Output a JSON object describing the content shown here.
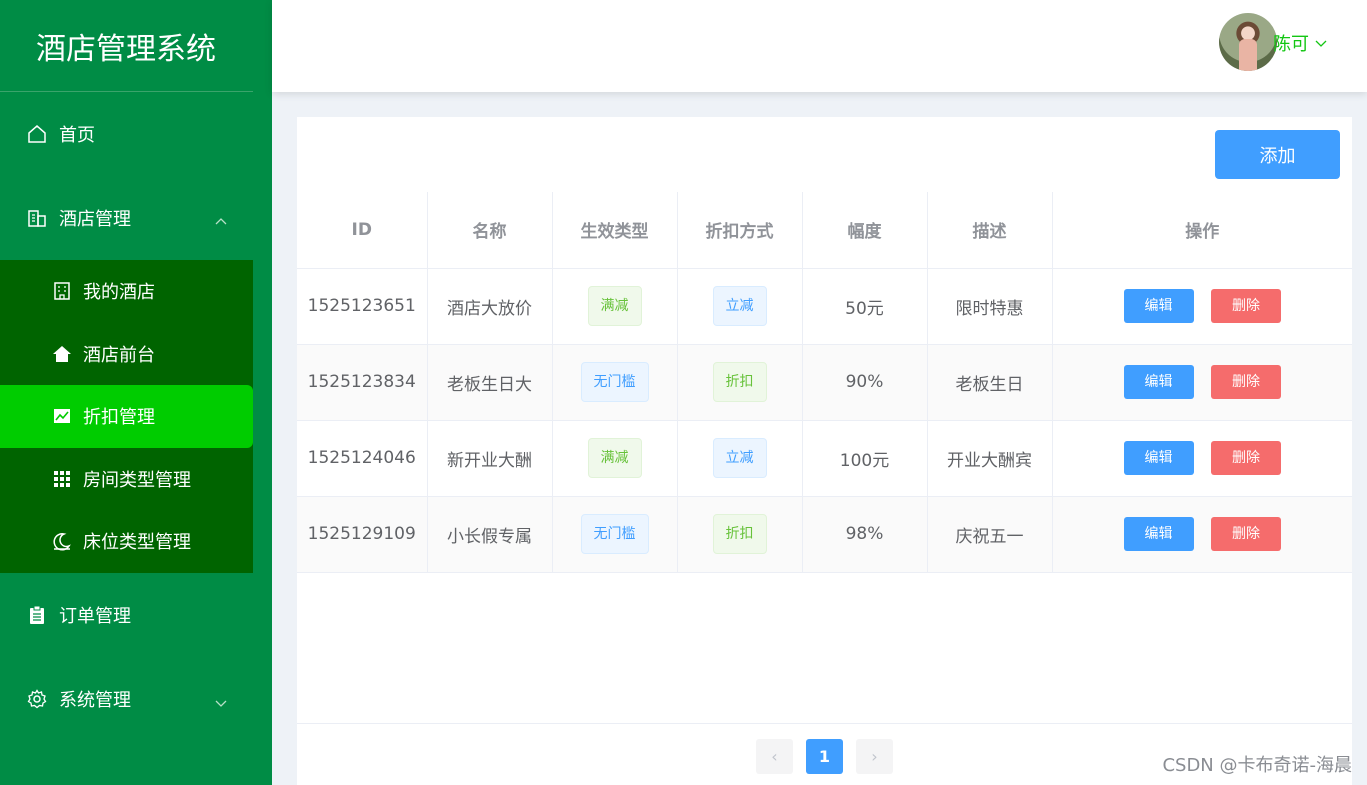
{
  "app": {
    "title": "酒店管理系统"
  },
  "sidebar": {
    "items": [
      {
        "label": "首页",
        "icon": "home-icon"
      },
      {
        "label": "酒店管理",
        "icon": "building-icon",
        "expanded": true,
        "children": [
          {
            "label": "我的酒店",
            "icon": "office-icon"
          },
          {
            "label": "酒店前台",
            "icon": "house-icon"
          },
          {
            "label": "折扣管理",
            "icon": "chart-icon",
            "active": true
          },
          {
            "label": "房间类型管理",
            "icon": "grid-icon"
          },
          {
            "label": "床位类型管理",
            "icon": "moon-icon"
          }
        ]
      },
      {
        "label": "订单管理",
        "icon": "clipboard-icon"
      },
      {
        "label": "系统管理",
        "icon": "gear-icon",
        "expanded": false
      }
    ]
  },
  "header": {
    "username": "陈可"
  },
  "toolbar": {
    "add_label": "添加"
  },
  "table": {
    "headers": [
      "ID",
      "名称",
      "生效类型",
      "折扣方式",
      "幅度",
      "描述",
      "操作"
    ],
    "rows": [
      {
        "id": "1525123651",
        "name": "酒店大放价",
        "effect": "满减",
        "effect_type": "success",
        "mode": "立减",
        "mode_type": "primary",
        "amount": "50元",
        "desc": "限时特惠"
      },
      {
        "id": "1525123834",
        "name": "老板生日大",
        "effect": "无门槛",
        "effect_type": "primary",
        "mode": "折扣",
        "mode_type": "success",
        "amount": "90%",
        "desc": "老板生日"
      },
      {
        "id": "1525124046",
        "name": "新开业大酬",
        "effect": "满减",
        "effect_type": "success",
        "mode": "立减",
        "mode_type": "primary",
        "amount": "100元",
        "desc": "开业大酬宾"
      },
      {
        "id": "1525129109",
        "name": "小长假专属",
        "effect": "无门槛",
        "effect_type": "primary",
        "mode": "折扣",
        "mode_type": "success",
        "amount": "98%",
        "desc": "庆祝五一"
      }
    ],
    "edit_label": "编辑",
    "delete_label": "删除"
  },
  "pagination": {
    "current": "1",
    "prev": "‹",
    "next": "›"
  },
  "watermark": "CSDN @卡布奇诺-海晨",
  "colors": {
    "sidebar": "#008c45",
    "submenu": "#006400",
    "active": "#00cc00",
    "primary": "#409eff",
    "danger": "#f56c6c"
  }
}
